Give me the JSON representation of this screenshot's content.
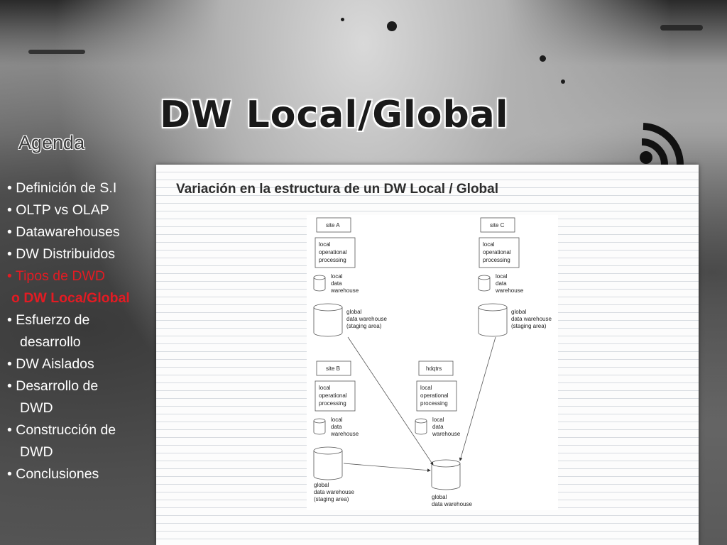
{
  "slide": {
    "title": "DW Local/Global",
    "agenda_heading": "Agenda",
    "subtitle": "Variación en la estructura de un DW Local / Global",
    "rss_icon": "rss-feed-icon",
    "agenda_items": [
      {
        "label": "• Definición de S.I",
        "active": false
      },
      {
        "label": "• OLTP vs OLAP",
        "active": false
      },
      {
        "label": "• Datawarehouses",
        "active": false
      },
      {
        "label": "• DW Distribuidos",
        "active": false
      },
      {
        "label": "• Tipos de DWD",
        "active": true
      },
      {
        "label": "o  DW Loca/Global",
        "active": true
      },
      {
        "label": "• Esfuerzo de",
        "active": false
      },
      {
        "label": "desarrollo",
        "active": false
      },
      {
        "label": "• DW Aislados",
        "active": false
      },
      {
        "label": "• Desarrollo de",
        "active": false
      },
      {
        "label": "DWD",
        "active": false
      },
      {
        "label": "• Construcción de",
        "active": false
      },
      {
        "label": "DWD",
        "active": false
      },
      {
        "label": "• Conclusiones",
        "active": false
      }
    ],
    "colors": {
      "active": "#e31b23",
      "text": "#ffffff"
    }
  },
  "diagram": {
    "site_a": {
      "label": "site A",
      "processing": [
        "local",
        "operational",
        "processing"
      ],
      "local_dw": [
        "local",
        "data",
        "warehouse"
      ],
      "global_dw": [
        "global",
        "data warehouse",
        "(staging area)"
      ]
    },
    "site_c": {
      "label": "site C",
      "processing": [
        "local",
        "operational",
        "processing"
      ],
      "local_dw": [
        "local",
        "data",
        "warehouse"
      ],
      "global_dw": [
        "global",
        "data warehouse",
        "(staging area)"
      ]
    },
    "site_b": {
      "label": "site B",
      "processing": [
        "local",
        "operational",
        "processing"
      ],
      "local_dw": [
        "local",
        "data",
        "warehouse"
      ],
      "global_dw": [
        "global",
        "data warehouse",
        "(staging area)"
      ]
    },
    "hq": {
      "label": "hdqtrs",
      "processing": [
        "local",
        "operational",
        "processing"
      ],
      "local_dw": [
        "local",
        "data",
        "warehouse"
      ],
      "global_dw": [
        "global",
        "data warehouse"
      ]
    }
  }
}
